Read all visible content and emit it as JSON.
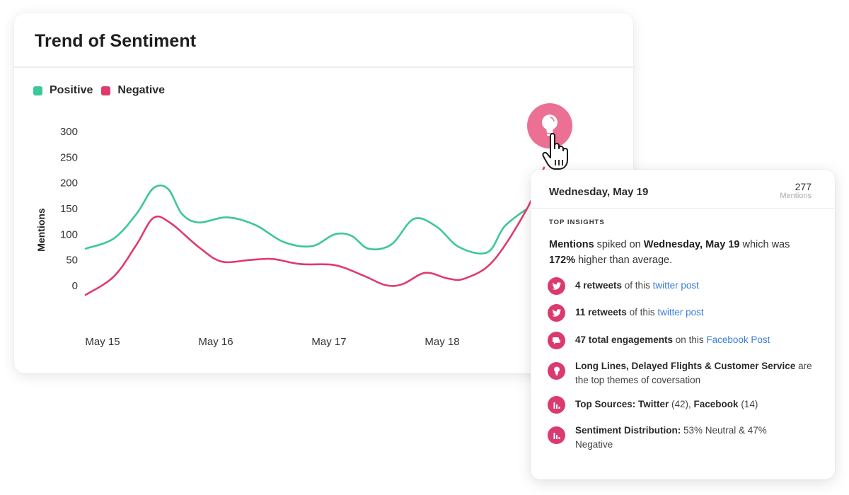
{
  "card": {
    "title": "Trend of Sentiment"
  },
  "legend": [
    {
      "label": "Positive",
      "color": "#3cc796"
    },
    {
      "label": "Negative",
      "color": "#e03a6b"
    }
  ],
  "chart_data": {
    "type": "line",
    "title": "Trend of Sentiment",
    "xlabel": "",
    "ylabel": "Mentions",
    "ylim": [
      0,
      300
    ],
    "yticks": [
      0,
      50,
      100,
      150,
      200,
      250,
      300
    ],
    "x_tick_labels": [
      "May 15",
      "May 16",
      "May 17",
      "May 18"
    ],
    "x_domain_days": [
      15,
      19
    ],
    "legend_position": "top-left",
    "grid": false,
    "series": [
      {
        "name": "Positive",
        "color": "#3cc796",
        "points": [
          [
            14.85,
            72
          ],
          [
            15.1,
            92
          ],
          [
            15.3,
            140
          ],
          [
            15.45,
            190
          ],
          [
            15.58,
            188
          ],
          [
            15.7,
            140
          ],
          [
            15.85,
            123
          ],
          [
            16.1,
            133
          ],
          [
            16.35,
            118
          ],
          [
            16.6,
            85
          ],
          [
            16.85,
            77
          ],
          [
            17.05,
            100
          ],
          [
            17.2,
            97
          ],
          [
            17.35,
            72
          ],
          [
            17.55,
            80
          ],
          [
            17.75,
            130
          ],
          [
            17.95,
            115
          ],
          [
            18.15,
            75
          ],
          [
            18.4,
            65
          ],
          [
            18.55,
            115
          ],
          [
            18.75,
            150
          ]
        ]
      },
      {
        "name": "Negative",
        "color": "#e03a6b",
        "points": [
          [
            14.85,
            -18
          ],
          [
            15.1,
            18
          ],
          [
            15.3,
            80
          ],
          [
            15.45,
            132
          ],
          [
            15.6,
            122
          ],
          [
            15.85,
            75
          ],
          [
            16.05,
            47
          ],
          [
            16.3,
            50
          ],
          [
            16.5,
            52
          ],
          [
            16.75,
            42
          ],
          [
            17.05,
            40
          ],
          [
            17.3,
            20
          ],
          [
            17.5,
            1
          ],
          [
            17.65,
            3
          ],
          [
            17.85,
            25
          ],
          [
            18.05,
            14
          ],
          [
            18.2,
            14
          ],
          [
            18.45,
            48
          ],
          [
            18.75,
            150
          ],
          [
            18.9,
            230
          ]
        ]
      }
    ]
  },
  "popup": {
    "date": "Wednesday, May 19",
    "mentions_count": "277",
    "mentions_label": "Mentions",
    "section_title": "TOP INSIGHTS",
    "summary": {
      "part1_bold": "Mentions",
      "part2": " spiked on ",
      "part3_bold": "Wednesday, May 19",
      "part4": " which was ",
      "part5_bold": "172%",
      "part6": " higher than average."
    },
    "insights": [
      {
        "icon": "twitter-icon",
        "bold": "4 retweets",
        "text": " of this ",
        "link": "twitter post"
      },
      {
        "icon": "twitter-icon",
        "bold": "11 retweets",
        "text": " of this ",
        "link": "twitter post"
      },
      {
        "icon": "comment-icon",
        "bold": "47 total engagements",
        "text": " on this ",
        "link": "Facebook Post"
      },
      {
        "icon": "lightbulb-icon",
        "bold": "Long Lines, Delayed Flights & Customer Service",
        "text": " are the top themes of coversation",
        "link": ""
      },
      {
        "icon": "bar-chart-icon",
        "bold": "Top Sources: Twitter",
        "text": " (42), ",
        "bold2": "Facebook",
        "text2": " (14)"
      },
      {
        "icon": "bar-chart-icon",
        "bold": "Sentiment Distribution:",
        "text": " 53% Neutral & 47% Negative"
      }
    ]
  },
  "colors": {
    "positive": "#3cc796",
    "negative": "#e03a6b",
    "accent_bubble": "#ec6f94",
    "icon_bg": "#db3a6e",
    "link": "#3b7ddd"
  }
}
